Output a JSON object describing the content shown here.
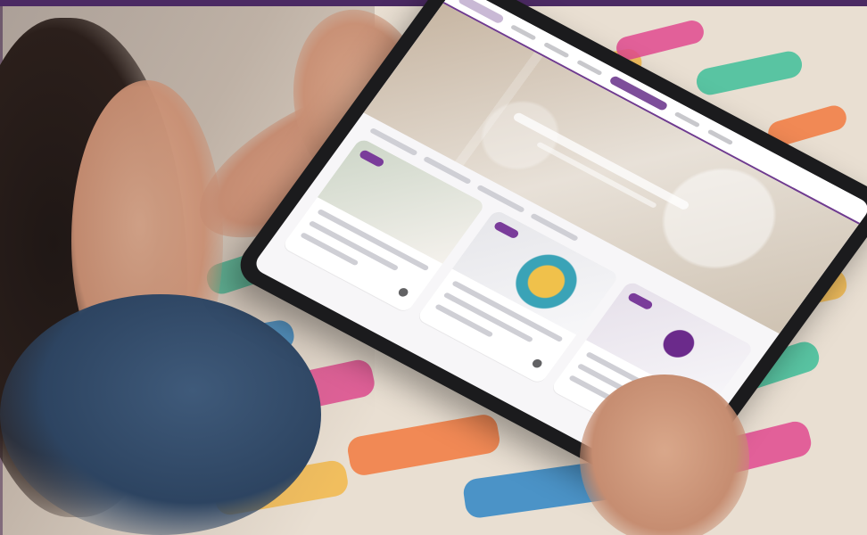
{
  "colors": {
    "top_bar": "#4b2a63",
    "tablet_accent": "#6f3b8f"
  },
  "elements": {
    "photo": "photo",
    "tablet": "tablet",
    "tablet_screen": "tablet-screen"
  }
}
